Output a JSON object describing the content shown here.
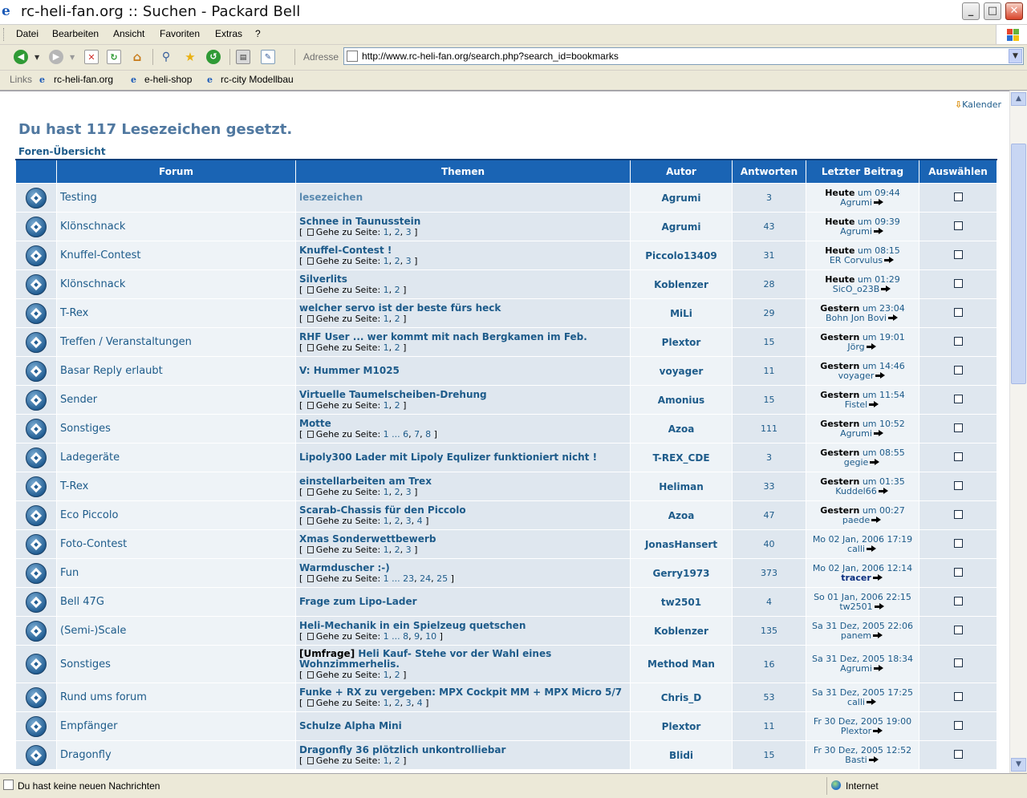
{
  "window": {
    "title": "rc-heli-fan.org :: Suchen - Packard Bell",
    "minimize": "_",
    "maximize": "□",
    "close": "✕"
  },
  "menu": [
    "Datei",
    "Bearbeiten",
    "Ansicht",
    "Favoriten",
    "Extras",
    "?"
  ],
  "toolbar": {
    "address_label": "Adresse",
    "url": "http://www.rc-heli-fan.org/search.php?search_id=bookmarks",
    "icons": [
      "back-icon",
      "forward-icon",
      "stop-icon",
      "refresh-icon",
      "home-icon",
      "search-icon",
      "favorites-icon",
      "history-icon",
      "print-icon",
      "edit-icon"
    ]
  },
  "links_bar": {
    "label": "Links",
    "links": [
      "rc-heli-fan.org",
      "e-heli-shop",
      "rc-city Modellbau"
    ]
  },
  "page": {
    "calendar_link": "Kalender",
    "heading": "Du hast 117 Lesezeichen gesetzt.",
    "breadcrumb": "Foren-Übersicht",
    "goto_label": "Gehe zu Seite:",
    "columns": [
      "Forum",
      "Themen",
      "Autor",
      "Antworten",
      "Letzter Beitrag",
      "Auswählen"
    ],
    "rows": [
      {
        "forum": "Testing",
        "prefix": "",
        "topic": "lesezeichen",
        "pages": [],
        "author": "Agrumi",
        "replies": "3",
        "date_bold": "Heute",
        "date_rest": "um 09:44",
        "last_user": "Agrumi"
      },
      {
        "forum": "Klönschnack",
        "prefix": "",
        "topic": "Schnee in Taunusstein",
        "pages": [
          "1",
          "2",
          "3"
        ],
        "author": "Agrumi",
        "replies": "43",
        "date_bold": "Heute",
        "date_rest": "um 09:39",
        "last_user": "Agrumi"
      },
      {
        "forum": "Knuffel-Contest",
        "prefix": "",
        "topic": "Knuffel-Contest !",
        "pages": [
          "1",
          "2",
          "3"
        ],
        "author": "Piccolo13409",
        "replies": "31",
        "date_bold": "Heute",
        "date_rest": "um 08:15",
        "last_user": "ER Corvulus"
      },
      {
        "forum": "Klönschnack",
        "prefix": "",
        "topic": "Silverlits",
        "pages": [
          "1",
          "2"
        ],
        "author": "Koblenzer",
        "replies": "28",
        "date_bold": "Heute",
        "date_rest": "um 01:29",
        "last_user": "SicO_o23B"
      },
      {
        "forum": "T-Rex",
        "prefix": "",
        "topic": "welcher servo ist der beste fürs heck",
        "pages": [
          "1",
          "2"
        ],
        "author": "MiLi",
        "replies": "29",
        "date_bold": "Gestern",
        "date_rest": "um 23:04",
        "last_user": "Bohn Jon Bovi"
      },
      {
        "forum": "Treffen / Veranstaltungen",
        "prefix": "",
        "topic": "RHF User ... wer kommt mit nach Bergkamen im Feb.",
        "pages": [
          "1",
          "2"
        ],
        "author": "Plextor",
        "replies": "15",
        "date_bold": "Gestern",
        "date_rest": "um 19:01",
        "last_user": "Jörg"
      },
      {
        "forum": "Basar Reply erlaubt",
        "prefix": "",
        "topic": "V: Hummer M1025",
        "pages": [],
        "author": "voyager",
        "replies": "11",
        "date_bold": "Gestern",
        "date_rest": "um 14:46",
        "last_user": "voyager"
      },
      {
        "forum": "Sender",
        "prefix": "",
        "topic": "Virtuelle Taumelscheiben-Drehung",
        "pages": [
          "1",
          "2"
        ],
        "author": "Amonius",
        "replies": "15",
        "date_bold": "Gestern",
        "date_rest": "um 11:54",
        "last_user": "Fistel"
      },
      {
        "forum": "Sonstiges",
        "prefix": "",
        "topic": "Motte",
        "pages": [
          "1 ... 6",
          "7",
          "8"
        ],
        "author": "Azoa",
        "replies": "111",
        "date_bold": "Gestern",
        "date_rest": "um 10:52",
        "last_user": "Agrumi"
      },
      {
        "forum": "Ladegeräte",
        "prefix": "",
        "topic": "Lipoly300 Lader mit Lipoly Equlizer funktioniert nicht !",
        "pages": [],
        "author": "T-REX_CDE",
        "replies": "3",
        "date_bold": "Gestern",
        "date_rest": "um 08:55",
        "last_user": "gegie"
      },
      {
        "forum": "T-Rex",
        "prefix": "",
        "topic": "einstellarbeiten am Trex",
        "pages": [
          "1",
          "2",
          "3"
        ],
        "author": "Heliman",
        "replies": "33",
        "date_bold": "Gestern",
        "date_rest": "um 01:35",
        "last_user": "Kuddel66"
      },
      {
        "forum": "Eco Piccolo",
        "prefix": "",
        "topic": "Scarab-Chassis für den Piccolo",
        "pages": [
          "1",
          "2",
          "3",
          "4"
        ],
        "author": "Azoa",
        "replies": "47",
        "date_bold": "Gestern",
        "date_rest": "um 00:27",
        "last_user": "paede"
      },
      {
        "forum": "Foto-Contest",
        "prefix": "",
        "topic": "Xmas Sonderwettbewerb",
        "pages": [
          "1",
          "2",
          "3"
        ],
        "author": "JonasHansert",
        "replies": "40",
        "date_bold": "",
        "date_rest": "Mo 02 Jan, 2006 17:19",
        "last_user": "calli"
      },
      {
        "forum": "Fun",
        "prefix": "",
        "topic": "Warmduscher :-)",
        "pages": [
          "1 ... 23",
          "24",
          "25"
        ],
        "author": "Gerry1973",
        "replies": "373",
        "date_bold": "",
        "date_rest": "Mo 02 Jan, 2006 12:14",
        "last_user": "tracer",
        "last_user_strong": true
      },
      {
        "forum": "Bell 47G",
        "prefix": "",
        "topic": "Frage zum Lipo-Lader",
        "pages": [],
        "author": "tw2501",
        "replies": "4",
        "date_bold": "",
        "date_rest": "So 01 Jan, 2006 22:15",
        "last_user": "tw2501"
      },
      {
        "forum": "(Semi-)Scale",
        "prefix": "",
        "topic": "Heli-Mechanik in ein Spielzeug quetschen",
        "pages": [
          "1 ... 8",
          "9",
          "10"
        ],
        "author": "Koblenzer",
        "replies": "135",
        "date_bold": "",
        "date_rest": "Sa 31 Dez, 2005 22:06",
        "last_user": "panem"
      },
      {
        "forum": "Sonstiges",
        "prefix": "[Umfrage]",
        "topic": "Heli Kauf- Stehe vor der Wahl eines Wohnzimmerhelis.",
        "pages": [
          "1",
          "2"
        ],
        "author": "Method Man",
        "replies": "16",
        "date_bold": "",
        "date_rest": "Sa 31 Dez, 2005 18:34",
        "last_user": "Agrumi"
      },
      {
        "forum": "Rund ums forum",
        "prefix": "",
        "topic": "Funke + RX zu vergeben: MPX Cockpit MM + MPX Micro 5/7",
        "pages": [
          "1",
          "2",
          "3",
          "4"
        ],
        "author": "Chris_D",
        "replies": "53",
        "date_bold": "",
        "date_rest": "Sa 31 Dez, 2005 17:25",
        "last_user": "calli"
      },
      {
        "forum": "Empfänger",
        "prefix": "",
        "topic": "Schulze Alpha Mini",
        "pages": [],
        "author": "Plextor",
        "replies": "11",
        "date_bold": "",
        "date_rest": "Fr 30 Dez, 2005 19:00",
        "last_user": "Plextor"
      },
      {
        "forum": "Dragonfly",
        "prefix": "",
        "topic": "Dragonfly 36 plötzlich unkontrolliebar",
        "pages": [
          "1",
          "2"
        ],
        "author": "Blidi",
        "replies": "15",
        "date_bold": "",
        "date_rest": "Fr 30 Dez, 2005 12:52",
        "last_user": "Basti"
      }
    ]
  },
  "status": {
    "message": "Du hast keine neuen Nachrichten",
    "zone": "Internet"
  }
}
